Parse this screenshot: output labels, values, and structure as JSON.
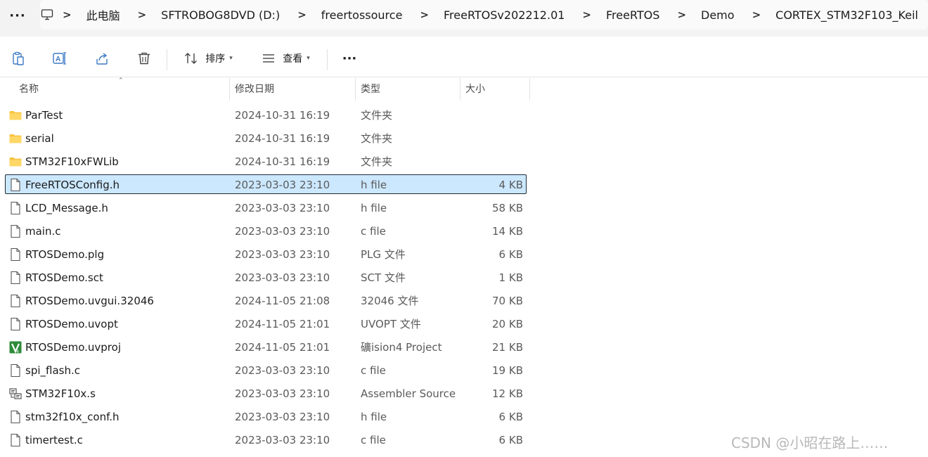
{
  "address_bar": {
    "crumbs": [
      "此电脑",
      "SFTROBOG8DVD (D:)",
      "freertossource",
      "FreeRTOSv202212.01",
      "FreeRTOS",
      "Demo",
      "CORTEX_STM32F103_Keil"
    ],
    "separator": ">",
    "more_label": "···"
  },
  "toolbar": {
    "sort_label": "排序",
    "view_label": "查看",
    "more_label": "···"
  },
  "columns": {
    "name": "名称",
    "date": "修改日期",
    "type": "类型",
    "size": "大小"
  },
  "files": [
    {
      "name": "ParTest",
      "date": "2024-10-31 16:19",
      "type": "文件夹",
      "size": "",
      "icon": "folder-icon"
    },
    {
      "name": "serial",
      "date": "2024-10-31 16:19",
      "type": "文件夹",
      "size": "",
      "icon": "folder-icon"
    },
    {
      "name": "STM32F10xFWLib",
      "date": "2024-10-31 16:19",
      "type": "文件夹",
      "size": "",
      "icon": "folder-icon"
    },
    {
      "name": "FreeRTOSConfig.h",
      "date": "2023-03-03 23:10",
      "type": "h file",
      "size": "4 KB",
      "icon": "file-icon",
      "selected": true
    },
    {
      "name": "LCD_Message.h",
      "date": "2023-03-03 23:10",
      "type": "h file",
      "size": "58 KB",
      "icon": "file-icon"
    },
    {
      "name": "main.c",
      "date": "2023-03-03 23:10",
      "type": "c file",
      "size": "14 KB",
      "icon": "file-icon"
    },
    {
      "name": "RTOSDemo.plg",
      "date": "2023-03-03 23:10",
      "type": "PLG 文件",
      "size": "6 KB",
      "icon": "file-icon"
    },
    {
      "name": "RTOSDemo.sct",
      "date": "2023-03-03 23:10",
      "type": "SCT 文件",
      "size": "1 KB",
      "icon": "file-icon"
    },
    {
      "name": "RTOSDemo.uvgui.32046",
      "date": "2024-11-05 21:08",
      "type": "32046 文件",
      "size": "70 KB",
      "icon": "file-icon"
    },
    {
      "name": "RTOSDemo.uvopt",
      "date": "2024-11-05 21:01",
      "type": "UVOPT 文件",
      "size": "20 KB",
      "icon": "file-icon"
    },
    {
      "name": "RTOSDemo.uvproj",
      "date": "2024-11-05 21:01",
      "type": "礦ision4 Project",
      "size": "21 KB",
      "icon": "keil-project-icon"
    },
    {
      "name": "spi_flash.c",
      "date": "2023-03-03 23:10",
      "type": "c file",
      "size": "19 KB",
      "icon": "file-icon"
    },
    {
      "name": "STM32F10x.s",
      "date": "2023-03-03 23:10",
      "type": "Assembler Source",
      "size": "12 KB",
      "icon": "assembler-source-icon"
    },
    {
      "name": "stm32f10x_conf.h",
      "date": "2023-03-03 23:10",
      "type": "h file",
      "size": "6 KB",
      "icon": "file-icon"
    },
    {
      "name": "timertest.c",
      "date": "2023-03-03 23:10",
      "type": "c file",
      "size": "6 KB",
      "icon": "file-icon"
    }
  ],
  "watermark": "CSDN @小昭在路上……",
  "colors": {
    "selection_bg": "#cce8ff",
    "folder_yellow": "#f8c443",
    "keil_green": "#2e8b3a"
  }
}
